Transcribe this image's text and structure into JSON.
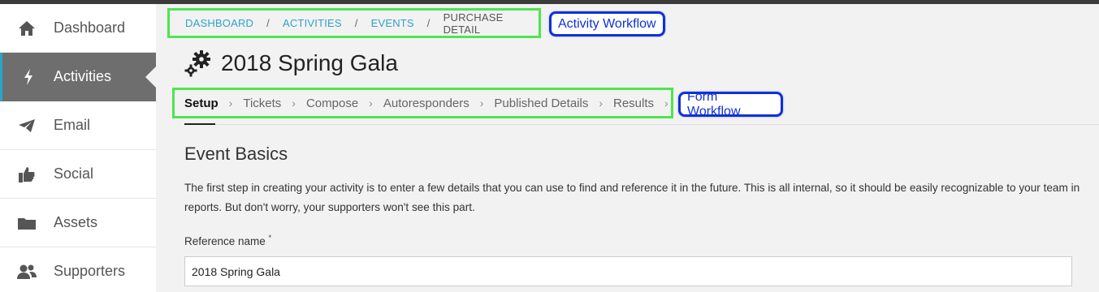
{
  "sidebar": {
    "items": [
      {
        "label": "Dashboard",
        "icon": "home-icon",
        "active": false
      },
      {
        "label": "Activities",
        "icon": "bolt-icon",
        "active": true
      },
      {
        "label": "Email",
        "icon": "paper-plane-icon",
        "active": false
      },
      {
        "label": "Social",
        "icon": "thumbs-up-icon",
        "active": false
      },
      {
        "label": "Assets",
        "icon": "folder-icon",
        "active": false
      },
      {
        "label": "Supporters",
        "icon": "users-icon",
        "active": false
      }
    ]
  },
  "breadcrumb": {
    "items": [
      "DASHBOARD",
      "ACTIVITIES",
      "EVENTS",
      "PURCHASE DETAIL"
    ],
    "separator": "/"
  },
  "annotations": {
    "activity_workflow": "Activity Workflow",
    "form_workflow": "Form Workflow"
  },
  "page": {
    "title": "2018 Spring Gala",
    "title_icon": "gears-icon"
  },
  "tabs": {
    "items": [
      "Setup",
      "Tickets",
      "Compose",
      "Autoresponders",
      "Published Details",
      "Results"
    ],
    "active_index": 0,
    "separator": "›"
  },
  "section": {
    "title": "Event Basics",
    "description_line1": "The first step in creating your activity is to enter a few details that you can use to find and reference it in the future. This is all internal, so it should be easily recognizable to your team in",
    "description_line2": "reports. But don't worry, your supporters won't see this part."
  },
  "form": {
    "reference_name": {
      "label": "Reference name",
      "required_mark": "*",
      "value": "2018 Spring Gala"
    }
  },
  "colors": {
    "accent": "#28a6c6",
    "annotation_green": "#4de64d",
    "annotation_blue": "#1030d8",
    "sidebar_active": "#6e6e6e"
  }
}
